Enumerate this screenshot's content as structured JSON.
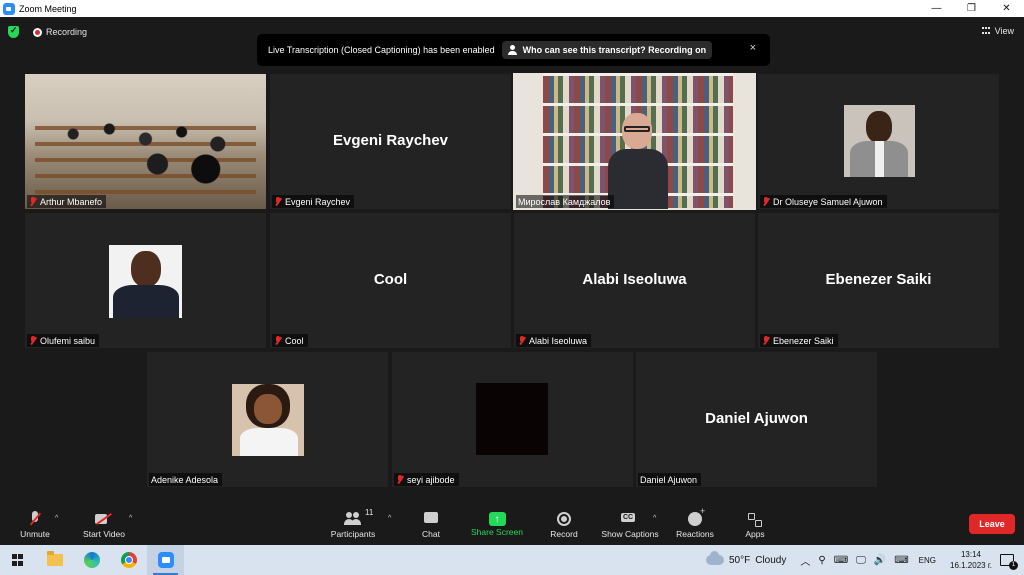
{
  "window": {
    "title": "Zoom Meeting",
    "minimize": "—",
    "restore": "❐",
    "close": "✕"
  },
  "topbar": {
    "recording_label": "Recording",
    "view_label": "View"
  },
  "banner": {
    "message": "Live Transcription (Closed Captioning) has been enabled",
    "link_label": "Who can see this transcript? Recording on",
    "close_glyph": "×"
  },
  "participants": [
    {
      "name": "Arthur Mbanefo",
      "muted": true,
      "type": "video-classroom"
    },
    {
      "name": "Evgeni Raychev",
      "muted": true,
      "type": "name"
    },
    {
      "name": "Мирослав Камджалов",
      "muted": false,
      "type": "video-bookshelf",
      "active_speaker": true
    },
    {
      "name": "Dr Oluseye Samuel Ajuwon",
      "muted": true,
      "type": "photo"
    },
    {
      "name": "Olufemi saibu",
      "muted": true,
      "type": "photo"
    },
    {
      "name": "Cool",
      "muted": true,
      "type": "name"
    },
    {
      "name": "Alabi Iseoluwa",
      "muted": true,
      "type": "name"
    },
    {
      "name": "Ebenezer Saiki",
      "muted": true,
      "type": "name"
    },
    {
      "name": "Adenike Adesola",
      "muted": false,
      "type": "photo"
    },
    {
      "name": "seyi ajibode",
      "muted": true,
      "type": "black"
    },
    {
      "name": "Daniel Ajuwon",
      "muted": false,
      "type": "name"
    }
  ],
  "toolbar": {
    "unmute": "Unmute",
    "start_video": "Start Video",
    "participants": "Participants",
    "participant_count": "11",
    "chat": "Chat",
    "share_screen": "Share Screen",
    "record": "Record",
    "show_captions": "Show Captions",
    "reactions": "Reactions",
    "apps": "Apps",
    "leave": "Leave",
    "caret": "^"
  },
  "taskbar": {
    "weather_temp": "50°F",
    "weather_desc": "Cloudy",
    "tray_up": "︿",
    "tray_glyphs": [
      "⚲",
      "⌨",
      "🖵",
      "🔊",
      "⌨"
    ],
    "language": "ENG",
    "time": "13:14",
    "date": "16.1.2023 г.",
    "notification_count": "1"
  },
  "colors": {
    "accent_green": "#23d959",
    "leave_red": "#e02828",
    "active_speaker": "#f0f05a",
    "zoom_blue": "#2d8cff"
  }
}
